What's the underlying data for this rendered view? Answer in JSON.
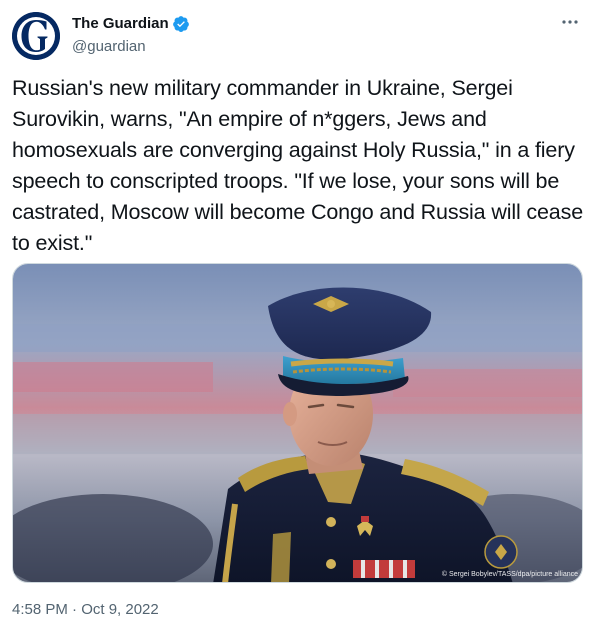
{
  "account": {
    "display_name": "The Guardian",
    "handle": "@guardian",
    "verified": true,
    "avatar_icon": "guardian-g-logo",
    "avatar_color": "#052962"
  },
  "menu": {
    "more_icon": "more-horizontal-icon"
  },
  "tweet": {
    "text": "Russian's new military commander in Ukraine, Sergei Surovikin, warns, \"An empire of n*ggers, Jews and homosexuals are converging against Holy Russia,\" in a fiery speech to conscripted troops. \"If we lose, your sons will be castrated, Moscow will become Congo and Russia will cease to exist.\"",
    "timestamp": "4:58 PM · Oct 9, 2022"
  },
  "media": {
    "photo_credit": "© Sergei Bobylev/TASS/dpa/picture alliance"
  },
  "colors": {
    "text_primary": "#0f1419",
    "text_secondary": "#536471",
    "verified_blue": "#1d9bf0",
    "border": "#cfd9de"
  }
}
